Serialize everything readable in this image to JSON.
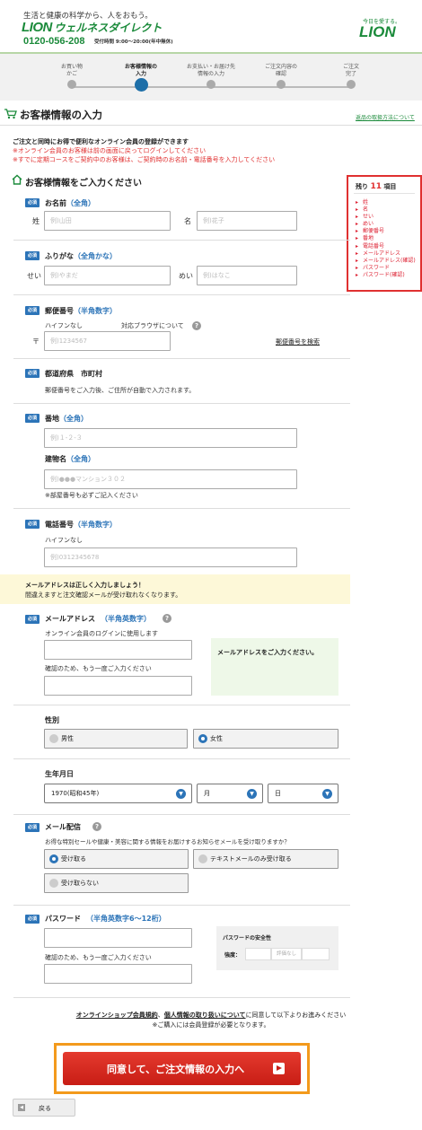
{
  "header": {
    "tagline": "生活と健康の科学から、人をおもう。",
    "brand": "LION",
    "brand_sub": "ウェルネスダイレクト",
    "phone": "0120-056-208",
    "hours": "受付時間 9:00〜20:00(年中無休)",
    "right_tagline": "今日を愛する。",
    "right_logo": "LION"
  },
  "steps": [
    {
      "label": "お買い物\nかご",
      "active": false
    },
    {
      "label": "お客様情報の\n入力",
      "active": true
    },
    {
      "label": "お支払い・お届け先\n情報の入力",
      "active": false
    },
    {
      "label": "ご注文内容の\n確認",
      "active": false
    },
    {
      "label": "ご注文\n完了",
      "active": false
    }
  ],
  "page": {
    "title": "お客様情報の入力",
    "product_link": "返品の取扱方法について",
    "intro": "ご注文と同時にお得で便利なオンライン会員の登録ができます",
    "notice1": "※オンライン会員のお客様は前の画面に戻ってログインしてください",
    "notice2": "※すでに定期コースをご契約中のお客様は、ご契約時のお名前・電話番号を入力してください",
    "section_title": "お客様情報をご入力ください"
  },
  "sidebar": {
    "prefix": "残り",
    "count": "11",
    "suffix": "項目",
    "items": [
      "姓",
      "名",
      "せい",
      "めい",
      "郵便番号",
      "番地",
      "電話番号",
      "メールアドレス",
      "メールアドレス(確認)",
      "パスワード",
      "パスワード(確認)"
    ]
  },
  "required_badge": "必須",
  "name": {
    "label": "お名前",
    "hint": "（全角）",
    "sei_label": "姓",
    "mei_label": "名",
    "sei_ph": "例)山田",
    "mei_ph": "例)花子"
  },
  "kana": {
    "label": "ふりがな",
    "hint": "（全角かな）",
    "sei_label": "せい",
    "mei_label": "めい",
    "sei_ph": "例)やまだ",
    "mei_ph": "例)はなこ"
  },
  "postal": {
    "label": "郵便番号",
    "hint": "（半角数字）",
    "sub": "ハイフンなし",
    "browser": "対応ブラウザについて",
    "mark": "〒",
    "ph": "例)1234567",
    "search": "郵便番号を検索"
  },
  "pref": {
    "label": "都道府県　市町村",
    "note": "郵便番号をご入力後、ご住所が自動で入力されます。"
  },
  "address": {
    "label": "番地",
    "hint": "（全角）",
    "ph": "例)１-２-３",
    "building_label": "建物名",
    "building_hint": "（全角）",
    "building_ph": "例)●●●マンション３０２",
    "building_note": "※部屋番号も必ずご記入ください"
  },
  "tel": {
    "label": "電話番号",
    "hint": "（半角数字）",
    "sub": "ハイフンなし",
    "ph": "例)0312345678"
  },
  "mail_notice": {
    "line1": "メールアドレスは正しく入力しましょう！",
    "line2": "間違えますと注文確認メールが受け取れなくなります。"
  },
  "email": {
    "label": "メールアドレス",
    "hint": "（半角英数字）",
    "sub1": "オンライン会員のログインに使用します",
    "sub2": "確認のため、もう一度ご入力ください",
    "status": "メールアドレスをご入力ください。"
  },
  "gender": {
    "label": "性別",
    "male": "男性",
    "female": "女性",
    "selected": "女性"
  },
  "birth": {
    "label": "生年月日",
    "year": "1970(昭和45年)",
    "month": "月",
    "day": "日"
  },
  "mailmag": {
    "label": "メール配信",
    "question": "お得な特別セールや健康・美容に関する情報をお届けするお知らせメールを受け取りますか？",
    "opt1": "受け取る",
    "opt2": "テキストメールのみ受け取る",
    "opt3": "受け取らない",
    "selected": "受け取る"
  },
  "password": {
    "label": "パスワード",
    "hint": "（半角英数字6〜12桁）",
    "sub": "確認のため、もう一度ご入力ください",
    "strength_title": "パスワードの安全性",
    "strength_label": "強度：",
    "strength_value": "評価なし"
  },
  "agree": {
    "link1": "オンラインショップ会員規約",
    "sep": "、",
    "link2": "個人情報の取り扱いについて",
    "text": "に同意して以下よりお進みください",
    "note": "※ご購入には会員登録が必要となります。"
  },
  "cta": {
    "label": "同意して、ご注文情報の入力へ"
  },
  "back": {
    "label": "戻る"
  },
  "colors": {
    "accent": "#2c74b8",
    "red": "#e03030",
    "green": "#1a8a3a",
    "cta": "#d9261c",
    "cta_border": "#f39a1c"
  }
}
